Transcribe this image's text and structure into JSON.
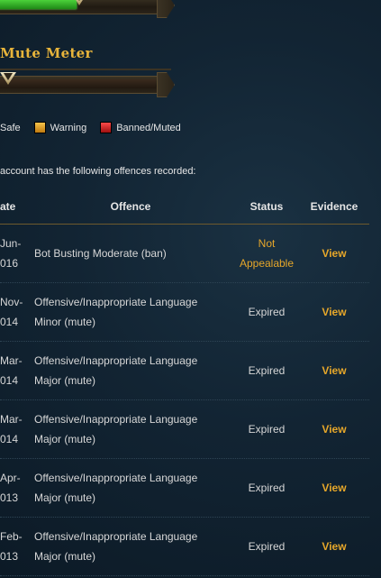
{
  "mute_meter": {
    "title": "Mute Meter",
    "level": 0.02
  },
  "ban_meter": {
    "level": 0.48
  },
  "legend": [
    {
      "label": "Safe",
      "color": "#2ea81f"
    },
    {
      "label": "Warning",
      "color": "#e6a72a"
    },
    {
      "label": "Banned/Muted",
      "color": "#d62020"
    }
  ],
  "intro": "account has the following offences recorded:",
  "table": {
    "headers": {
      "date": "ate",
      "offence": "Offence",
      "status": "Status",
      "evidence": "Evidence"
    },
    "rows": [
      {
        "date_1": "Jun-",
        "date_2": "016",
        "offence": "Bot Busting Moderate (ban)",
        "status_1": "Not",
        "status_2": "Appealable",
        "status_type": "not-appealable",
        "evidence": "View"
      },
      {
        "date_1": "Nov-",
        "date_2": "014",
        "offence": "Offensive/Inappropriate Language Minor (mute)",
        "status_1": "Expired",
        "status_2": "",
        "status_type": "expired",
        "evidence": "View"
      },
      {
        "date_1": "Mar-",
        "date_2": "014",
        "offence": "Offensive/Inappropriate Language Major (mute)",
        "status_1": "Expired",
        "status_2": "",
        "status_type": "expired",
        "evidence": "View"
      },
      {
        "date_1": "Mar-",
        "date_2": "014",
        "offence": "Offensive/Inappropriate Language Major (mute)",
        "status_1": "Expired",
        "status_2": "",
        "status_type": "expired",
        "evidence": "View"
      },
      {
        "date_1": "Apr-",
        "date_2": "013",
        "offence": "Offensive/Inappropriate Language Major (mute)",
        "status_1": "Expired",
        "status_2": "",
        "status_type": "expired",
        "evidence": "View"
      },
      {
        "date_1": "Feb-",
        "date_2": "013",
        "offence": "Offensive/Inappropriate Language Major (mute)",
        "status_1": "Expired",
        "status_2": "",
        "status_type": "expired",
        "evidence": "View"
      }
    ]
  }
}
